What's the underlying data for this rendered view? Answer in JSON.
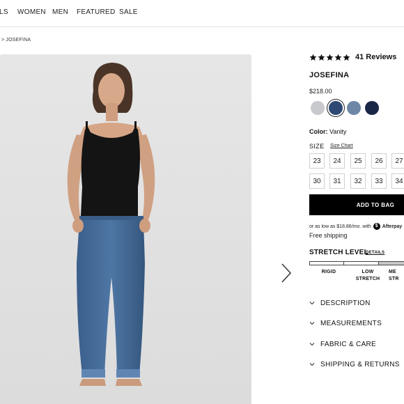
{
  "nav": {
    "items": [
      "LS",
      "WOMEN",
      "MEN",
      "FEATURED",
      "SALE"
    ]
  },
  "breadcrumb": "> JOSEFINA",
  "product": {
    "rating_stars": 5,
    "reviews_text": "41 Reviews",
    "title": "JOSEFINA",
    "price": "$218.00",
    "swatches": [
      {
        "name": "light-gray",
        "color": "#c8c9cc"
      },
      {
        "name": "vanity",
        "color": "#2e4a74"
      },
      {
        "name": "mid-blue",
        "color": "#6e87a6"
      },
      {
        "name": "dark-navy",
        "color": "#1b2747"
      }
    ],
    "color_label": "Color:",
    "color_value": "Vanity",
    "size_label": "SIZE",
    "size_chart": "Size Chart",
    "sizes_row1": [
      "23",
      "24",
      "25",
      "26",
      "27"
    ],
    "sizes_row2": [
      "30",
      "31",
      "32",
      "33",
      "34"
    ],
    "add_to_bag": "ADD TO BAG",
    "afterpay_text": "or as low as $18.86/mo. with",
    "afterpay_name": "Afterpay",
    "shipping": "Free shipping",
    "stretch_heading": "STRETCH LEVEL",
    "stretch_details": "DETAILS",
    "stretch_labels": [
      "RIGID",
      "LOW STRETCH",
      "ME STR"
    ],
    "accordion": [
      "DESCRIPTION",
      "MEASUREMENTS",
      "FABRIC & CARE",
      "SHIPPING & RETURNS"
    ]
  },
  "colors": {
    "accent": "#000000",
    "border": "#d0d0d0",
    "photo_bg": "#e3e3e3"
  },
  "icons": {
    "star": "star-icon",
    "next": "chevron-right-icon",
    "accordion": "chevron-down-icon",
    "afterpay": "afterpay-logo-icon",
    "info": "info-icon"
  }
}
